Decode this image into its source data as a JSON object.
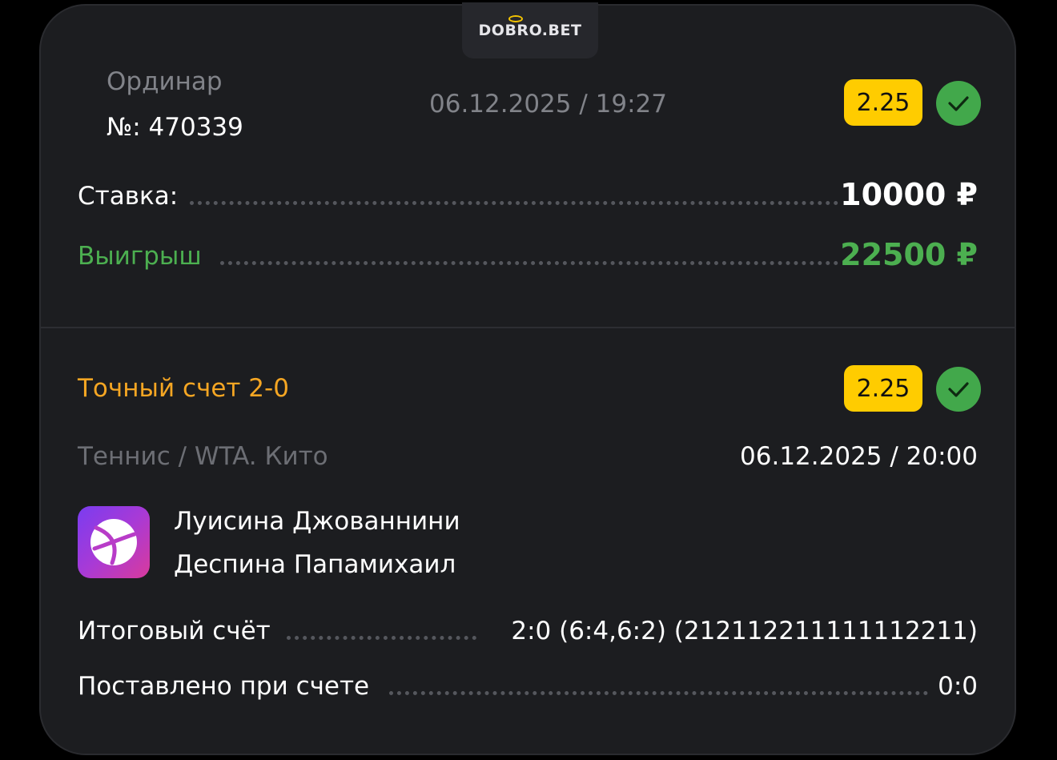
{
  "brand": {
    "logo_text": "DOBRO.BET",
    "accent": "#f5c400"
  },
  "header": {
    "bet_type": "Ординар",
    "number_label": "№: 470339",
    "datetime": "06.12.2025 / 19:27",
    "odds": "2.25",
    "status_icon": "check-icon",
    "status_color": "#42a84b"
  },
  "summary": {
    "stake_label": "Ставка:",
    "stake_value": "10000 ₽",
    "win_label": "Выигрыш",
    "win_value": "22500 ₽",
    "win_color": "#4caf50"
  },
  "event": {
    "market": "Точный счет 2-0",
    "odds": "2.25",
    "status_icon": "check-icon",
    "league": "Теннис / WTA. Кито",
    "datetime": "06.12.2025 / 20:00",
    "sport_icon": "tennis-ball-icon",
    "player1": "Луисина Джованнини",
    "player2": "Деспина Папамихаил",
    "final_score_label": "Итоговый счёт",
    "final_score_value": "2:0 (6:4,6:2) (212112211111112211)",
    "placed_at_label": "Поставлено при счете",
    "placed_at_value": "0:0"
  }
}
